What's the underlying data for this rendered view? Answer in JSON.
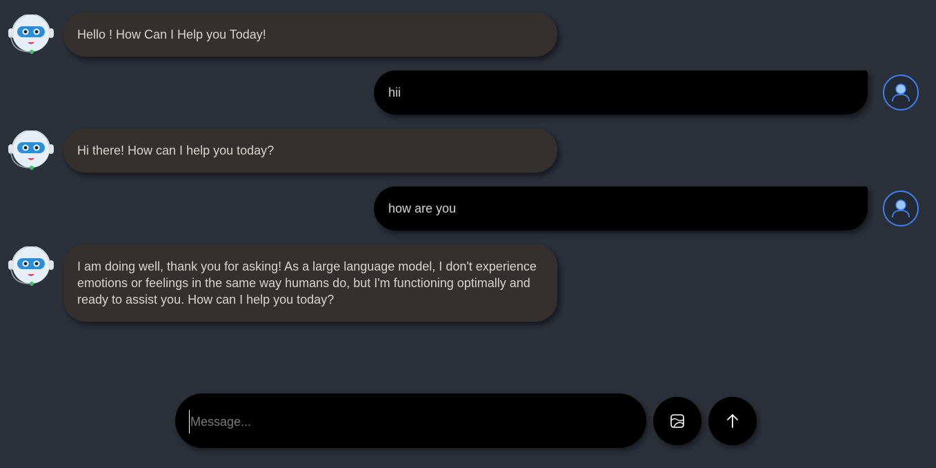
{
  "messages": [
    {
      "role": "bot",
      "text": "Hello ! How Can I Help you Today!"
    },
    {
      "role": "user",
      "text": "hii"
    },
    {
      "role": "bot",
      "text": "Hi there! How can I help you today?"
    },
    {
      "role": "user",
      "text": "how are you"
    },
    {
      "role": "bot",
      "text": "I am doing well, thank you for asking! As a large language model, I don't experience emotions or feelings in the same way humans do, but I'm functioning optimally and ready to assist you. How can I help you today?"
    }
  ],
  "composer": {
    "placeholder": "Message...",
    "value": ""
  },
  "buttons": {
    "attach_icon": "image-icon",
    "send_icon": "arrow-up-icon"
  },
  "colors": {
    "background": "#2b3039",
    "bot_bubble": "#33302e",
    "user_bubble": "#000000",
    "text": "#d9d3cd",
    "user_avatar_accent": "#3b82f6",
    "bot_face_accent": "#2a8fd6"
  }
}
